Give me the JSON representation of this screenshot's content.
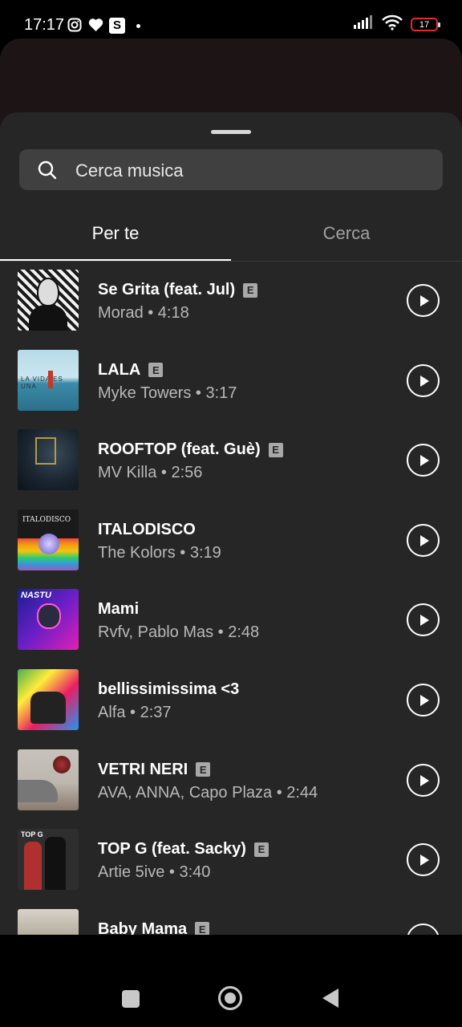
{
  "status_bar": {
    "time": "17:17",
    "battery_level": "17",
    "icons": [
      "instagram-icon",
      "heart-icon",
      "s-app-icon",
      "dot-icon",
      "signal-icon",
      "wifi-icon",
      "battery-icon"
    ]
  },
  "search": {
    "placeholder": "Cerca musica",
    "icon": "search-icon"
  },
  "tabs": [
    {
      "label": "Per te",
      "active": true
    },
    {
      "label": "Cerca",
      "active": false
    }
  ],
  "songs": [
    {
      "title": "Se Grita (feat. Jul)",
      "subtitle": "Morad • 4:18",
      "explicit": true
    },
    {
      "title": "LALA",
      "subtitle": "Myke Towers • 3:17",
      "explicit": true,
      "cover_text": "LA VIDA ES UNA"
    },
    {
      "title": "ROOFTOP (feat. Guè)",
      "subtitle": "MV Killa • 2:56",
      "explicit": true
    },
    {
      "title": "ITALODISCO",
      "subtitle": "The Kolors • 3:19",
      "explicit": false,
      "cover_text": "ITALODISCO"
    },
    {
      "title": "Mami",
      "subtitle": "Rvfv, Pablo Mas • 2:48",
      "explicit": false,
      "cover_text": "NASTU"
    },
    {
      "title": "bellissimissima <3",
      "subtitle": "Alfa • 2:37",
      "explicit": false
    },
    {
      "title": "VETRI NERI",
      "subtitle": "AVA, ANNA, Capo Plaza • 2:44",
      "explicit": true
    },
    {
      "title": "TOP G (feat. Sacky)",
      "subtitle": "Artie 5ive • 3:40",
      "explicit": true,
      "cover_text": "TOP G"
    },
    {
      "title": "Baby Mama",
      "subtitle": "",
      "explicit": true
    }
  ],
  "explicit_badge": "E",
  "colors": {
    "sheet_bg": "#262626",
    "search_bg": "#404040",
    "secondary_text": "#b8b8b8",
    "battery_low": "#e02a2a"
  }
}
